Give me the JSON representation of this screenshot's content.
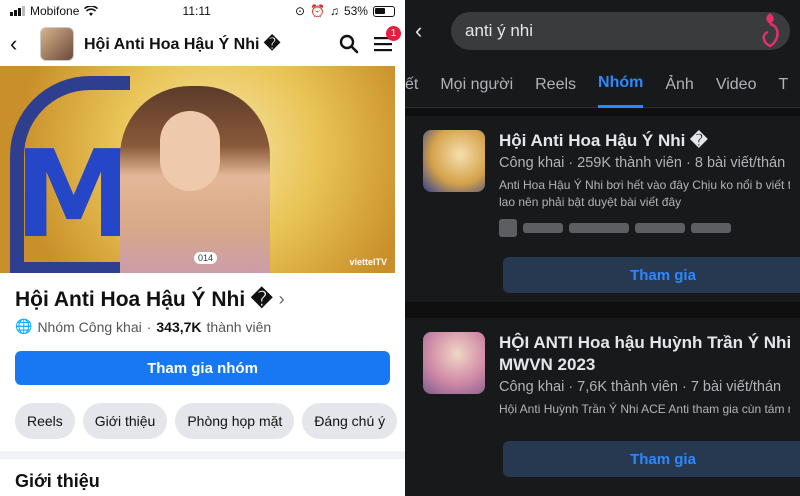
{
  "left": {
    "status": {
      "carrier": "Mobifone",
      "time": "11:11",
      "battery": "53%"
    },
    "header": {
      "title": "Hội Anti Hoa Hậu Ý Nhi �",
      "badge": "1"
    },
    "cover": {
      "contestant_tag": "014",
      "brand": "viettelTV"
    },
    "group": {
      "name": "Hội Anti Hoa Hậu Ý Nhi �",
      "privacy": "Nhóm Công khai",
      "members": "343,7K",
      "members_suffix": "thành viên",
      "join_label": "Tham gia nhóm"
    },
    "chips": [
      "Reels",
      "Giới thiệu",
      "Phòng họp mặt",
      "Đáng chú ý"
    ],
    "section_title": "Giới thiệu"
  },
  "right": {
    "search": {
      "query": "anti ý nhi"
    },
    "tabs": [
      "ết",
      "Mọi người",
      "Reels",
      "Nhóm",
      "Ảnh",
      "Video",
      "T"
    ],
    "active_tab": "Nhóm",
    "results": [
      {
        "title": "Hội Anti Hoa Hậu Ý Nhi �",
        "meta": "Công khai · 259K thành viên · 8 bài viết/thán",
        "desc": "Anti Hoa Hậu Ý Nhi bơi hết vào đây Chịu ko nổi b viết tào lao nên phải bật duyệt bài viết đây",
        "join_label": "Tham gia"
      },
      {
        "title": "HỘI ANTI Hoa hậu Huỳnh Trần Ý Nhi MWVN 2023",
        "meta": "Công khai · 7,6K thành viên · 7 bài viết/thán",
        "desc": "Hội Anti Huỳnh Trần Ý Nhi ACE Anti tham gia cùn tám nhé!!!",
        "join_label": "Tham gia"
      }
    ]
  },
  "colors": {
    "fb_blue": "#1877f2",
    "dark_bg": "#18191a",
    "active_blue": "#2d88ff"
  }
}
